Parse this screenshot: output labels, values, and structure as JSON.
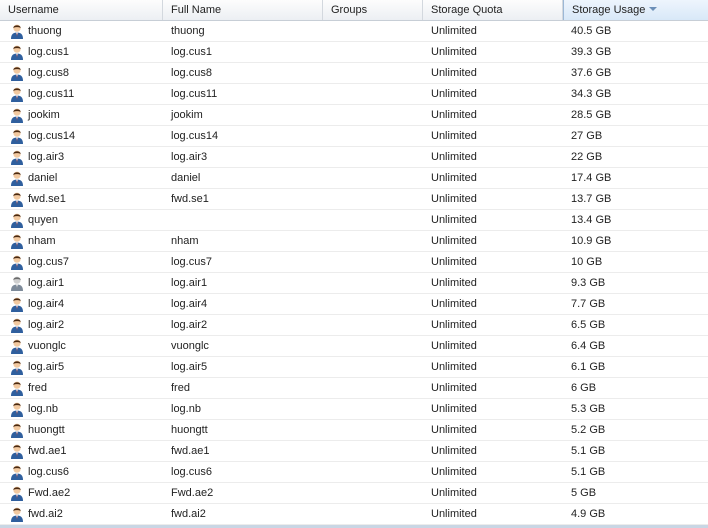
{
  "columns": {
    "username": "Username",
    "full_name": "Full Name",
    "groups": "Groups",
    "storage_quota": "Storage Quota",
    "storage_usage": "Storage Usage"
  },
  "sort": {
    "column": "storage_usage",
    "direction": "descending"
  },
  "icons": {
    "user": "user-icon",
    "sort": "sort-descending-icon"
  },
  "colors": {
    "header_sorted": "#d8e8f8",
    "row_border": "#ececec"
  },
  "users": [
    {
      "username": "thuong",
      "full_name": "thuong",
      "groups": "",
      "quota": "Unlimited",
      "usage": "40.5 GB"
    },
    {
      "username": "log.cus1",
      "full_name": "log.cus1",
      "groups": "",
      "quota": "Unlimited",
      "usage": "39.3 GB"
    },
    {
      "username": "log.cus8",
      "full_name": "log.cus8",
      "groups": "",
      "quota": "Unlimited",
      "usage": "37.6 GB"
    },
    {
      "username": "log.cus11",
      "full_name": "log.cus11",
      "groups": "",
      "quota": "Unlimited",
      "usage": "34.3 GB"
    },
    {
      "username": "jookim",
      "full_name": "jookim",
      "groups": "",
      "quota": "Unlimited",
      "usage": "28.5 GB"
    },
    {
      "username": "log.cus14",
      "full_name": "log.cus14",
      "groups": "",
      "quota": "Unlimited",
      "usage": "27 GB"
    },
    {
      "username": "log.air3",
      "full_name": "log.air3",
      "groups": "",
      "quota": "Unlimited",
      "usage": "22 GB"
    },
    {
      "username": "daniel",
      "full_name": "daniel",
      "groups": "",
      "quota": "Unlimited",
      "usage": "17.4 GB"
    },
    {
      "username": "fwd.se1",
      "full_name": "fwd.se1",
      "groups": "",
      "quota": "Unlimited",
      "usage": "13.7 GB"
    },
    {
      "username": "quyen",
      "full_name": "",
      "groups": "",
      "quota": "Unlimited",
      "usage": "13.4 GB"
    },
    {
      "username": "nham",
      "full_name": "nham",
      "groups": "",
      "quota": "Unlimited",
      "usage": "10.9 GB"
    },
    {
      "username": "log.cus7",
      "full_name": "log.cus7",
      "groups": "",
      "quota": "Unlimited",
      "usage": "10 GB"
    },
    {
      "username": "log.air1",
      "full_name": "log.air1",
      "groups": "",
      "quota": "Unlimited",
      "usage": "9.3 GB",
      "grey": true
    },
    {
      "username": "log.air4",
      "full_name": "log.air4",
      "groups": "",
      "quota": "Unlimited",
      "usage": "7.7 GB"
    },
    {
      "username": "log.air2",
      "full_name": "log.air2",
      "groups": "",
      "quota": "Unlimited",
      "usage": "6.5 GB"
    },
    {
      "username": "vuonglc",
      "full_name": "vuonglc",
      "groups": "",
      "quota": "Unlimited",
      "usage": "6.4 GB"
    },
    {
      "username": "log.air5",
      "full_name": "log.air5",
      "groups": "",
      "quota": "Unlimited",
      "usage": "6.1 GB"
    },
    {
      "username": "fred",
      "full_name": "fred",
      "groups": "",
      "quota": "Unlimited",
      "usage": "6 GB"
    },
    {
      "username": "log.nb",
      "full_name": "log.nb",
      "groups": "",
      "quota": "Unlimited",
      "usage": "5.3 GB"
    },
    {
      "username": "huongtt",
      "full_name": "huongtt",
      "groups": "",
      "quota": "Unlimited",
      "usage": "5.2 GB"
    },
    {
      "username": "fwd.ae1",
      "full_name": "fwd.ae1",
      "groups": "",
      "quota": "Unlimited",
      "usage": "5.1 GB"
    },
    {
      "username": "log.cus6",
      "full_name": "log.cus6",
      "groups": "",
      "quota": "Unlimited",
      "usage": "5.1 GB"
    },
    {
      "username": "Fwd.ae2",
      "full_name": "Fwd.ae2",
      "groups": "",
      "quota": "Unlimited",
      "usage": "5 GB"
    },
    {
      "username": "fwd.ai2",
      "full_name": "fwd.ai2",
      "groups": "",
      "quota": "Unlimited",
      "usage": "4.9 GB"
    }
  ]
}
